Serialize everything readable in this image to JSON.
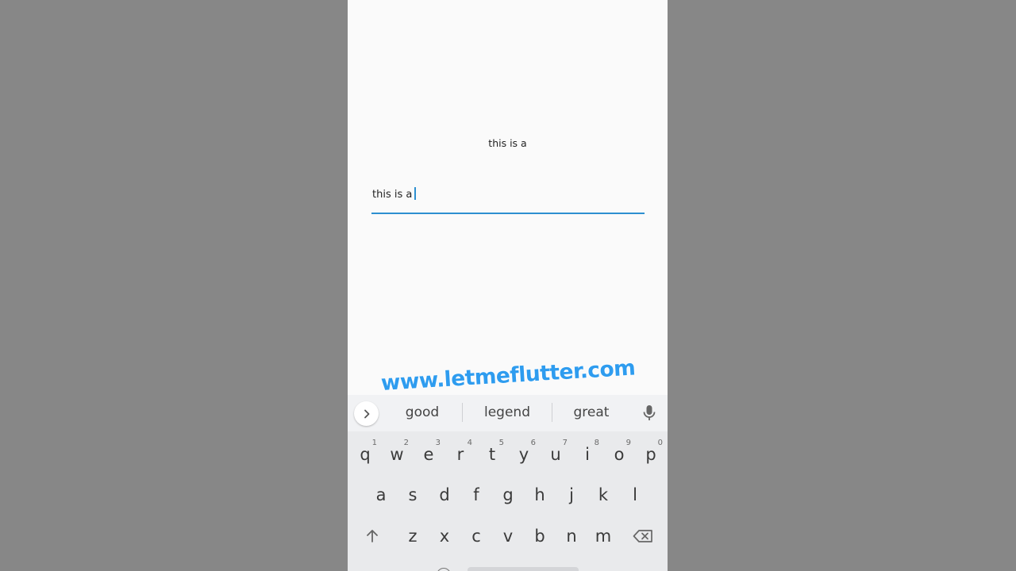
{
  "app": {
    "display_text": "this is a",
    "field_value": "this is a"
  },
  "watermark": "www.letmeflutter.com",
  "keyboard": {
    "suggestions": [
      "good",
      "legend",
      "great"
    ],
    "row1": [
      {
        "label": "q",
        "hint": "1"
      },
      {
        "label": "w",
        "hint": "2"
      },
      {
        "label": "e",
        "hint": "3"
      },
      {
        "label": "r",
        "hint": "4"
      },
      {
        "label": "t",
        "hint": "5"
      },
      {
        "label": "y",
        "hint": "6"
      },
      {
        "label": "u",
        "hint": "7"
      },
      {
        "label": "i",
        "hint": "8"
      },
      {
        "label": "o",
        "hint": "9"
      },
      {
        "label": "p",
        "hint": "0"
      }
    ],
    "row2": [
      "a",
      "s",
      "d",
      "f",
      "g",
      "h",
      "j",
      "k",
      "l"
    ],
    "row3": [
      "z",
      "x",
      "c",
      "v",
      "b",
      "n",
      "m"
    ],
    "icons": {
      "expand": "chevron-right-icon",
      "mic": "microphone-icon",
      "shift": "shift-arrow-icon",
      "backspace": "backspace-icon"
    }
  },
  "colors": {
    "accent": "#2d8fd0",
    "watermark": "#2e9cef",
    "backdrop": "#878787",
    "screen": "#fafafa",
    "keyboard": "#e9eaec"
  }
}
